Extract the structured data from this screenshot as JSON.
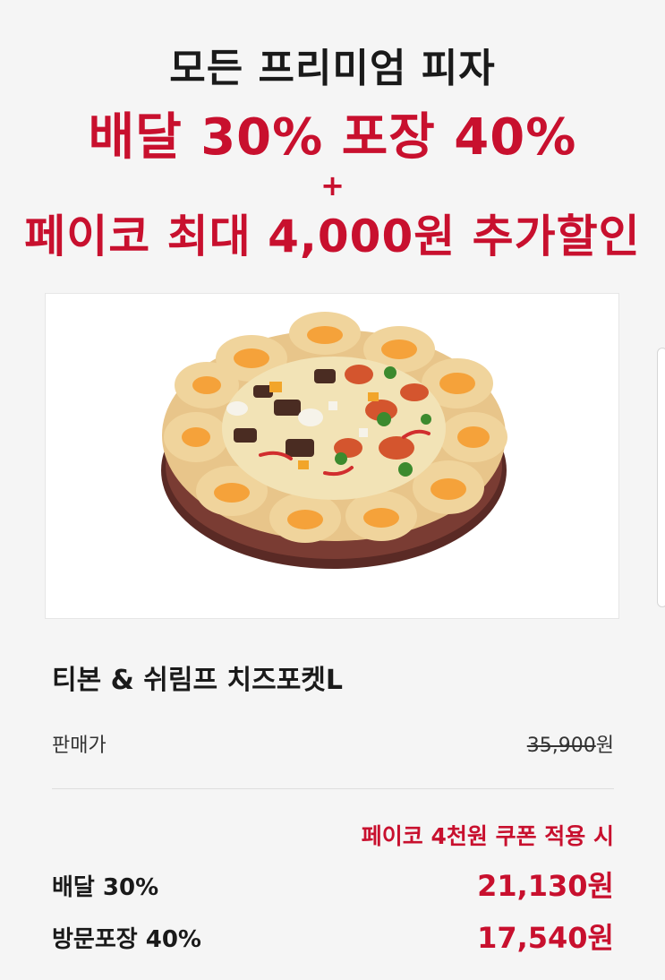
{
  "banner": {
    "line1": "모든 프리미엄 피자",
    "line2": "배달 30% 포장 40%",
    "line3": "+",
    "line4": "페이코 최대 4,000원 추가할인"
  },
  "product": {
    "name": "티본 & 쉬림프 치즈포켓L",
    "image_alt": "pizza-image"
  },
  "pricing": {
    "label": "판매가",
    "original_price": "35,900",
    "currency": "원",
    "coupon_note": "페이코 4천원 쿠폰 적용 시",
    "rows": [
      {
        "label": "배달 30%",
        "price": "21,130원"
      },
      {
        "label": "방문포장 40%",
        "price": "17,540원"
      }
    ]
  },
  "colors": {
    "accent": "#c8102e",
    "text": "#1a1a1a",
    "background": "#f5f5f5"
  }
}
